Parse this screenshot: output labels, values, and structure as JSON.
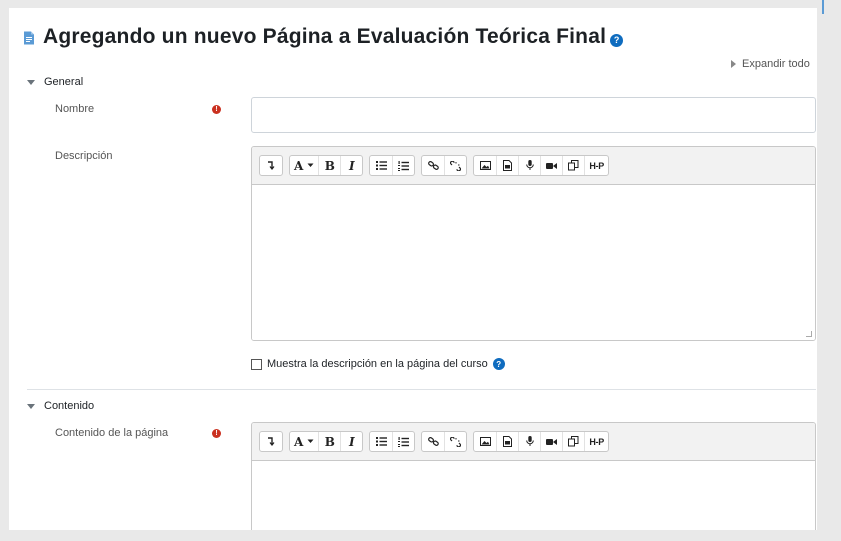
{
  "page": {
    "title": "Agregando un nuevo Página a Evaluación Teórica Final",
    "expand_all": "Expandir todo"
  },
  "sections": {
    "general": {
      "label": "General",
      "name_label": "Nombre",
      "description_label": "Descripción",
      "show_description_label": "Muestra la descripción en la página del curso"
    },
    "content": {
      "label": "Contenido",
      "page_content_label": "Contenido de la página"
    }
  },
  "toolbar": {
    "font_button": "A",
    "bold": "B",
    "italic": "I",
    "h5p": "H-P"
  },
  "icons": {
    "page": "page-icon",
    "help": "help-icon",
    "required": "required-icon",
    "expand": "caret-right-icon",
    "collapse": "caret-down-icon"
  },
  "colors": {
    "accent": "#0f6cbf",
    "required": "#ca3120",
    "page_icon": "#5b9bd5",
    "toolbar_bg": "#f2f2f2"
  }
}
